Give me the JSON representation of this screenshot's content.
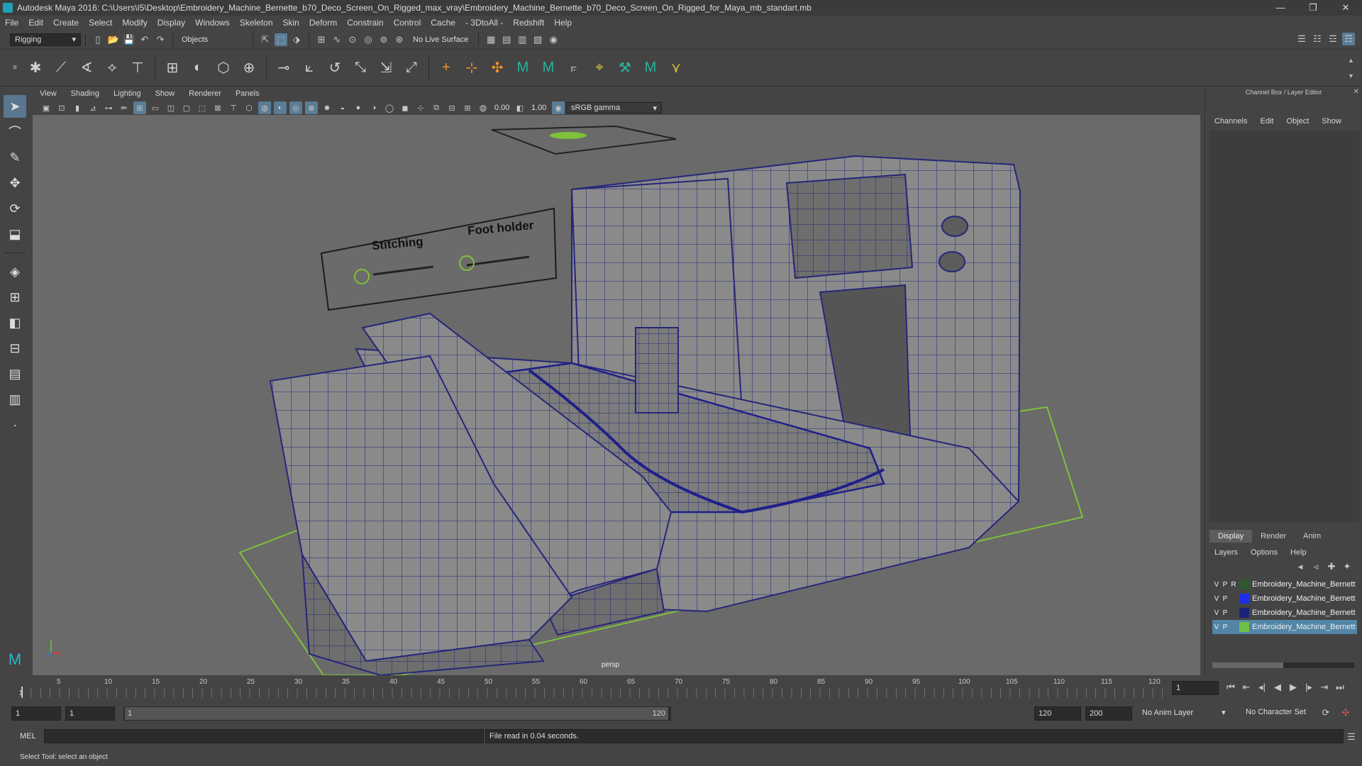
{
  "window": {
    "title": "Autodesk Maya 2016: C:\\Users\\I5\\Desktop\\Embroidery_Machine_Bernette_b70_Deco_Screen_On_Rigged_max_vray\\Embroidery_Machine_Bernette_b70_Deco_Screen_On_Rigged_for_Maya_mb_standart.mb",
    "minimize": "—",
    "restore": "❐",
    "close": "✕"
  },
  "menubar": [
    "File",
    "Edit",
    "Create",
    "Select",
    "Modify",
    "Display",
    "Windows",
    "Skeleton",
    "Skin",
    "Deform",
    "Constrain",
    "Control",
    "Cache",
    "- 3DtoAll -",
    "Redshift",
    "Help"
  ],
  "statusline": {
    "mode": "Rigging",
    "selection_mode": "Objects",
    "live_surface": "No Live Surface"
  },
  "viewport": {
    "menus": [
      "View",
      "Shading",
      "Lighting",
      "Show",
      "Renderer",
      "Panels"
    ],
    "exposure": "0.00",
    "gamma": "1.00",
    "color_space": "sRGB gamma",
    "camera_label": "persp",
    "annotation_left": "Stitching",
    "annotation_right": "Foot holder"
  },
  "channel_box": {
    "title": "Channel Box / Layer Editor",
    "menus": [
      "Channels",
      "Edit",
      "Object",
      "Show"
    ],
    "tabs": [
      "Display",
      "Render",
      "Anim"
    ],
    "layer_menus": [
      "Layers",
      "Options",
      "Help"
    ],
    "layers": [
      {
        "v": "V",
        "p": "P",
        "r": "R",
        "name": "Embroidery_Machine_Bernett",
        "color": "#2f5a2f",
        "selected": false
      },
      {
        "v": "V",
        "p": "P",
        "r": "",
        "name": "Embroidery_Machine_Bernett",
        "color": "#1c2ee8",
        "selected": false
      },
      {
        "v": "V",
        "p": "P",
        "r": "",
        "name": "Embroidery_Machine_Bernett",
        "color": "#1c237a",
        "selected": false
      },
      {
        "v": "V",
        "p": "P",
        "r": "",
        "name": "Embroidery_Machine_Bernett",
        "color": "#6ec047",
        "selected": true
      }
    ]
  },
  "timeline": {
    "ticks": [
      "5",
      "10",
      "15",
      "20",
      "25",
      "30",
      "35",
      "40",
      "45",
      "50",
      "55",
      "60",
      "65",
      "70",
      "75",
      "80",
      "85",
      "90",
      "95",
      "100",
      "105",
      "110",
      "115",
      "120"
    ],
    "current_frame_left": "1",
    "current_frame_field": "1"
  },
  "range": {
    "start": "1",
    "start_inner": "1",
    "slider_start": "1",
    "slider_end": "120",
    "end_inner": "120",
    "end": "200",
    "anim_layer": "No Anim Layer",
    "character_set": "No Character Set"
  },
  "cmdline": {
    "lang": "MEL",
    "result": "File read in  0.04 seconds."
  },
  "helpline": {
    "text": "Select Tool: select an object"
  }
}
